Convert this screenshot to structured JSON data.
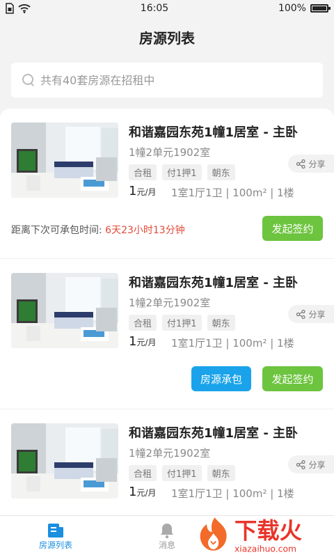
{
  "status_bar": {
    "time": "16:05",
    "battery": "100%"
  },
  "header": {
    "title": "房源列表"
  },
  "search": {
    "placeholder": "共有40套房源在招租中"
  },
  "listings": [
    {
      "title": "和谐嘉园东苑1幢1居室 - 主卧",
      "address": "1幢2单元1902室",
      "tags": [
        "合租",
        "付1押1",
        "朝东"
      ],
      "share_label": "分享",
      "price": "1",
      "price_unit": "元/月",
      "room_info": "1室1厅1卫 | 100m² | 1楼",
      "countdown_label": "距离下次可承包时间:",
      "countdown_value": "6天23小时13分钟",
      "primary_button": "发起签约"
    },
    {
      "title": "和谐嘉园东苑1幢1居室 - 主卧",
      "address": "1幢2单元1902室",
      "tags": [
        "合租",
        "付1押1",
        "朝东"
      ],
      "share_label": "分享",
      "price": "1",
      "price_unit": "元/月",
      "room_info": "1室1厅1卫 | 100m² | 1楼",
      "secondary_button": "房源承包",
      "primary_button": "发起签约"
    },
    {
      "title": "和谐嘉园东苑1幢1居室 - 主卧",
      "address": "1幢2单元1902室",
      "tags": [
        "合租",
        "付1押1",
        "朝东"
      ],
      "share_label": "分享",
      "price": "1",
      "price_unit": "元/月",
      "room_info": "1室1厅1卫 | 100m² | 1楼"
    }
  ],
  "tab_bar": {
    "tabs": [
      {
        "label": "房源列表",
        "icon": "house-list-icon",
        "active": true
      },
      {
        "label": "消息",
        "icon": "bell-icon",
        "active": false
      }
    ]
  },
  "watermark": {
    "brand": "下载火",
    "url": "xiazaihuo.com"
  },
  "colors": {
    "accent_blue": "#1aa3ea",
    "accent_green": "#6dc43f",
    "countdown_red": "#e04a3a",
    "tab_active": "#1a8fe0"
  }
}
